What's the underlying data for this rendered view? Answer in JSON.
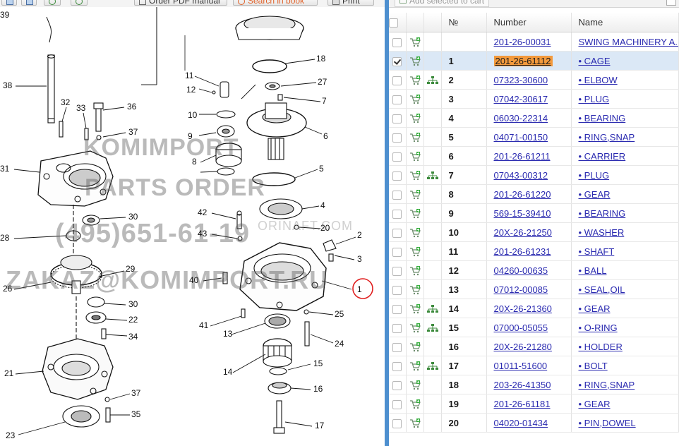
{
  "toolbar": {
    "order_pdf_label": "Order PDF manual",
    "search_label": "Search in book",
    "print_label": "Print"
  },
  "diagram": {
    "watermarks": [
      "KOMIMPORT",
      "PARTS ORDER",
      "(495)651-61-19",
      "ZAKAZ@KOMIMPORT.RU",
      "ORINAFT.COM"
    ],
    "callouts": [
      "39",
      "38",
      "32",
      "33",
      "36",
      "37",
      "31",
      "30",
      "28",
      "29",
      "26",
      "30",
      "22",
      "34",
      "21",
      "37",
      "35",
      "23",
      "11",
      "12",
      "10",
      "9",
      "8",
      "42",
      "43",
      "40",
      "41",
      "13",
      "14",
      "18",
      "27",
      "7",
      "6",
      "5",
      "4",
      "20",
      "2",
      "3",
      "1",
      "25",
      "24",
      "15",
      "16",
      "17"
    ]
  },
  "grid": {
    "add_to_cart_label": "Add selected to cart",
    "columns": {
      "no": "№",
      "number": "Number",
      "name": "Name"
    },
    "rows": [
      {
        "no": "",
        "number": "201-26-00031",
        "name": "SWING MACHINERY A...",
        "checked": false,
        "tree": false
      },
      {
        "no": "1",
        "number": "201-26-61112",
        "name": "• CAGE",
        "checked": true,
        "tree": false,
        "selected": true
      },
      {
        "no": "2",
        "number": "07323-30600",
        "name": "• ELBOW",
        "checked": false,
        "tree": true
      },
      {
        "no": "3",
        "number": "07042-30617",
        "name": "• PLUG",
        "checked": false,
        "tree": false
      },
      {
        "no": "4",
        "number": "06030-22314",
        "name": "• BEARING",
        "checked": false,
        "tree": false
      },
      {
        "no": "5",
        "number": "04071-00150",
        "name": "• RING,SNAP",
        "checked": false,
        "tree": false
      },
      {
        "no": "6",
        "number": "201-26-61211",
        "name": "• CARRIER",
        "checked": false,
        "tree": false
      },
      {
        "no": "7",
        "number": "07043-00312",
        "name": "• PLUG",
        "checked": false,
        "tree": true
      },
      {
        "no": "8",
        "number": "201-26-61220",
        "name": "• GEAR",
        "checked": false,
        "tree": false
      },
      {
        "no": "9",
        "number": "569-15-39410",
        "name": "• BEARING",
        "checked": false,
        "tree": false
      },
      {
        "no": "10",
        "number": "20X-26-21250",
        "name": "• WASHER",
        "checked": false,
        "tree": false
      },
      {
        "no": "11",
        "number": "201-26-61231",
        "name": "• SHAFT",
        "checked": false,
        "tree": false
      },
      {
        "no": "12",
        "number": "04260-00635",
        "name": "• BALL",
        "checked": false,
        "tree": false
      },
      {
        "no": "13",
        "number": "07012-00085",
        "name": "• SEAL,OIL",
        "checked": false,
        "tree": false
      },
      {
        "no": "14",
        "number": "20X-26-21360",
        "name": "• GEAR",
        "checked": false,
        "tree": true
      },
      {
        "no": "15",
        "number": "07000-05055",
        "name": "• O-RING",
        "checked": false,
        "tree": true
      },
      {
        "no": "16",
        "number": "20X-26-21280",
        "name": "• HOLDER",
        "checked": false,
        "tree": false
      },
      {
        "no": "17",
        "number": "01011-51600",
        "name": "• BOLT",
        "checked": false,
        "tree": true
      },
      {
        "no": "18",
        "number": "203-26-41350",
        "name": "• RING,SNAP",
        "checked": false,
        "tree": false
      },
      {
        "no": "19",
        "number": "201-26-61181",
        "name": "• GEAR",
        "checked": false,
        "tree": false
      },
      {
        "no": "20",
        "number": "04020-01434",
        "name": "• PIN,DOWEL",
        "checked": false,
        "tree": false
      }
    ]
  },
  "colors": {
    "divider": "#4d8fcf",
    "highlight": "#f39a3d",
    "selected_row": "#dbe8f6",
    "link": "#2a2ab0",
    "callout_circle": "#e02020"
  }
}
